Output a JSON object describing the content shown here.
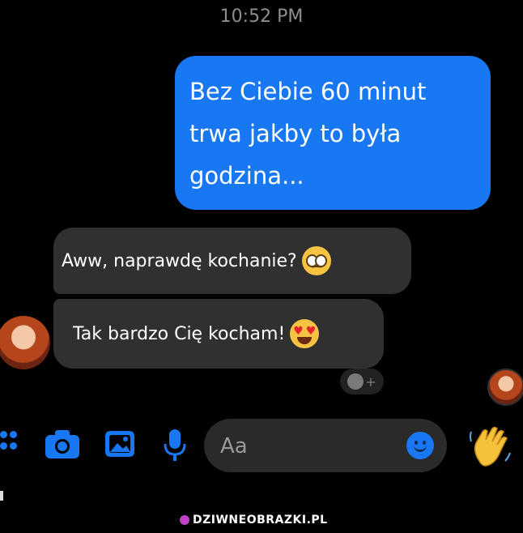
{
  "status_bar": {
    "time": "10:52 PM"
  },
  "messages": {
    "sent": [
      "Bez Ciebie 60 minut",
      "trwa jakby to była",
      "godzina..."
    ],
    "received": [
      {
        "text": "Aww, naprawdę kochanie?",
        "emoji": "pleading-face-emoji"
      },
      {
        "text": "Tak bardzo Cię kocham!",
        "emoji": "heart-eyes-emoji"
      }
    ]
  },
  "composer": {
    "placeholder": "Aa"
  },
  "toolbar_icons": [
    "apps-icon",
    "camera-icon",
    "image-icon",
    "microphone-icon",
    "emoji-icon",
    "waving-hand-icon"
  ],
  "watermark": "DZIWNEOBRAZKI.PL",
  "colors": {
    "background": "#000000",
    "sent_bubble": "#1877f2",
    "received_bubble": "#303030",
    "accent": "#1877f2"
  }
}
